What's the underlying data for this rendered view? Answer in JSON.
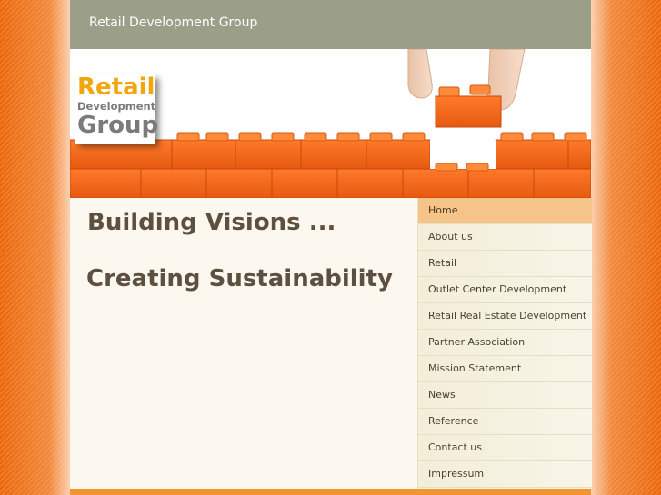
{
  "header": {
    "site_title": "Retail Development Group"
  },
  "logo": {
    "line1": "Retail",
    "line2": "Development",
    "line3": "Group"
  },
  "main": {
    "headline1": "Building Visions ...",
    "headline2": "Creating Sustainability"
  },
  "nav": {
    "items": [
      {
        "label": "Home",
        "active": true
      },
      {
        "label": "About us"
      },
      {
        "label": "Retail"
      },
      {
        "label": "Outlet Center Development"
      },
      {
        "label": "Retail Real Estate Development"
      },
      {
        "label": "Partner Association"
      },
      {
        "label": "Mission Statement"
      },
      {
        "label": "News"
      },
      {
        "label": "Reference"
      },
      {
        "label": "Contact us"
      },
      {
        "label": "Impressum"
      }
    ]
  },
  "colors": {
    "background_orange": "#e8650f",
    "topbar": "#9b9f87",
    "brick_orange": "#f26a1b",
    "nav_active": "#f6c489",
    "headline_text": "#5e5040",
    "logo_orange": "#f2a60d",
    "logo_gray": "#7a7a7a"
  }
}
